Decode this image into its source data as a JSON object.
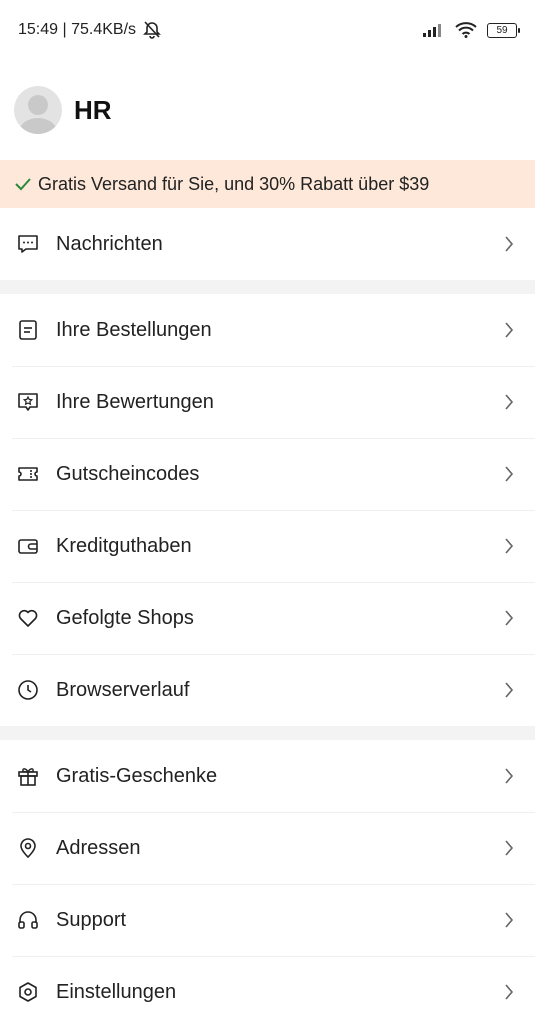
{
  "status_bar": {
    "time_speed": "15:49 | 75.4KB/s",
    "battery": "59"
  },
  "profile": {
    "name": "HR"
  },
  "promo": {
    "text": "Gratis Versand für Sie, und 30% Rabatt über $39"
  },
  "menu": {
    "group1": [
      {
        "label": "Nachrichten",
        "icon": "message-icon"
      }
    ],
    "group2": [
      {
        "label": "Ihre Bestellungen",
        "icon": "orders-icon"
      },
      {
        "label": "Ihre Bewertungen",
        "icon": "reviews-icon"
      },
      {
        "label": "Gutscheincodes",
        "icon": "coupon-icon"
      },
      {
        "label": "Kreditguthaben",
        "icon": "wallet-icon"
      },
      {
        "label": "Gefolgte Shops",
        "icon": "heart-icon"
      },
      {
        "label": "Browserverlauf",
        "icon": "clock-icon"
      }
    ],
    "group3": [
      {
        "label": "Gratis-Geschenke",
        "icon": "gift-icon"
      },
      {
        "label": "Adressen",
        "icon": "location-icon"
      },
      {
        "label": "Support",
        "icon": "headset-icon"
      },
      {
        "label": "Einstellungen",
        "icon": "settings-icon"
      }
    ]
  }
}
